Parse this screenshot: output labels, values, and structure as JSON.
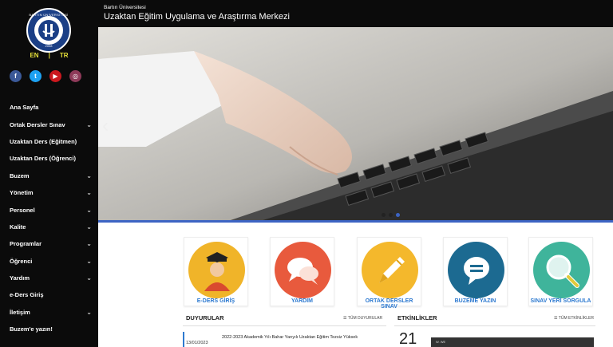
{
  "sidebar": {
    "logo": {
      "ring_text": "BARTIN ÜNİVERSİTESİ",
      "year": "2008"
    },
    "languages": [
      "EN",
      "|",
      "TR"
    ],
    "social": [
      {
        "icon": "facebook-icon",
        "glyph": "f",
        "color": "#3b5998"
      },
      {
        "icon": "twitter-icon",
        "glyph": "t",
        "color": "#1da1f2"
      },
      {
        "icon": "youtube-icon",
        "glyph": "▶",
        "color": "#cc181e"
      },
      {
        "icon": "instagram-icon",
        "glyph": "◎",
        "color": "#8e3a59"
      }
    ],
    "nav": [
      {
        "label": "Ana Sayfa",
        "has_sub": false
      },
      {
        "label": "Ortak Dersler Sınav",
        "has_sub": true
      },
      {
        "label": "Uzaktan Ders (Eğitmen)",
        "has_sub": false
      },
      {
        "label": "Uzaktan Ders (Öğrenci)",
        "has_sub": false
      },
      {
        "label": "Buzem",
        "has_sub": true
      },
      {
        "label": "Yönetim",
        "has_sub": true
      },
      {
        "label": "Personel",
        "has_sub": true
      },
      {
        "label": "Kalite",
        "has_sub": true
      },
      {
        "label": "Programlar",
        "has_sub": true
      },
      {
        "label": "Öğrenci",
        "has_sub": true
      },
      {
        "label": "Yardım",
        "has_sub": true
      },
      {
        "label": "e-Ders Giriş",
        "has_sub": false
      },
      {
        "label": "İletişim",
        "has_sub": true
      },
      {
        "label": "Buzem'e yazın!",
        "has_sub": false
      }
    ]
  },
  "header": {
    "small": "Bartın Üniversitesi",
    "title": "Uzaktan Eğitim Uygulama ve Araştırma Merkezi"
  },
  "slider": {
    "prev_glyph": "‹",
    "dots": 3,
    "active_dot": 2
  },
  "tiles": [
    {
      "label": "E-DERS GİRİŞ",
      "color": "#f0b429",
      "icon": "graduate-icon"
    },
    {
      "label": "YARDIM",
      "color": "#e85a3d",
      "icon": "chat-bubbles-icon"
    },
    {
      "label": "ORTAK DERSLER SINAV",
      "color": "#f4b82c",
      "icon": "pencil-icon"
    },
    {
      "label": "BUZEME YAZIN",
      "color": "#1c6a91",
      "icon": "message-icon"
    },
    {
      "label": "SINAV YERİ SORGULA",
      "color": "#3fb49b",
      "icon": "magnifier-icon"
    }
  ],
  "announcements": {
    "heading": "DUYURULAR",
    "all_link": "☰ TÜM DUYURULAR",
    "items": [
      {
        "date": "13/01/2023",
        "text": "2022-2023 Akademik Yılı Bahar Yarıyılı Uzaktan Eğitim Tezsiz Yüksek"
      }
    ]
  },
  "events": {
    "heading": "ETKİNLİKLER",
    "all_link": "☰ TÜM ETKİNLİKLER",
    "items": [
      {
        "day": "21",
        "image_text": "W. WE"
      }
    ]
  }
}
